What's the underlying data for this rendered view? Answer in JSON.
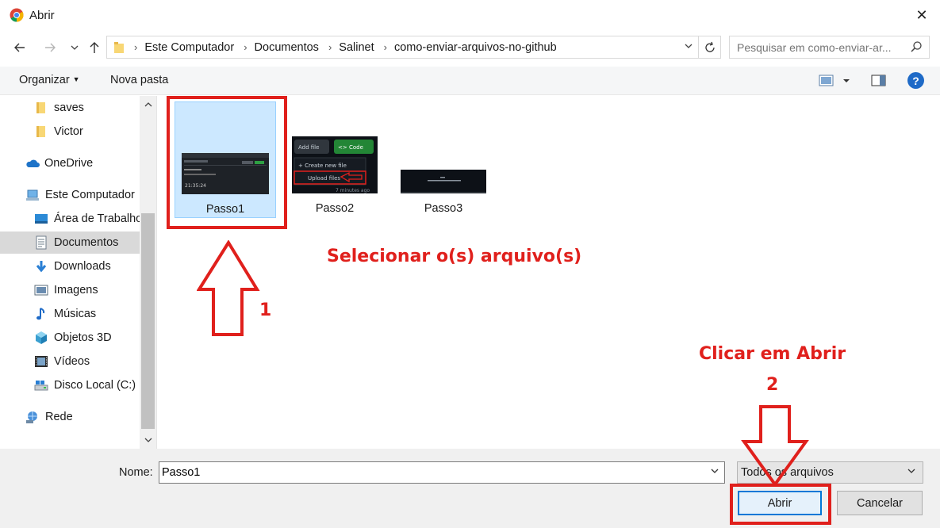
{
  "window": {
    "title": "Abrir",
    "close_label": "✕"
  },
  "nav": {
    "breadcrumbs": [
      "Este Computador",
      "Documentos",
      "Salinet",
      "como-enviar-arquivos-no-github"
    ],
    "search_placeholder": "Pesquisar em como-enviar-ar..."
  },
  "toolbar": {
    "organize_label": "Organizar",
    "new_folder_label": "Nova pasta",
    "help_label": "?"
  },
  "sidebar": {
    "items": [
      {
        "label": "saves",
        "icon": "folder-icon"
      },
      {
        "label": "Victor",
        "icon": "folder-icon"
      },
      {
        "label": "OneDrive",
        "icon": "cloud-icon"
      },
      {
        "label": "Este Computador",
        "icon": "computer-icon"
      },
      {
        "label": "Área de Trabalho",
        "icon": "desktop-icon"
      },
      {
        "label": "Documentos",
        "icon": "documents-icon",
        "selected": true
      },
      {
        "label": "Downloads",
        "icon": "download-icon"
      },
      {
        "label": "Imagens",
        "icon": "pictures-icon"
      },
      {
        "label": "Músicas",
        "icon": "music-icon"
      },
      {
        "label": "Objetos 3D",
        "icon": "cube-icon"
      },
      {
        "label": "Vídeos",
        "icon": "video-icon"
      },
      {
        "label": "Disco Local (C:)",
        "icon": "disk-icon"
      },
      {
        "label": "Rede",
        "icon": "network-icon"
      }
    ]
  },
  "files": [
    {
      "name": "Passo1",
      "selected": true
    },
    {
      "name": "Passo2",
      "selected": false
    },
    {
      "name": "Passo3",
      "selected": false
    }
  ],
  "thumb_text": {
    "passo1_time": "21:35:24",
    "passo2_add_file": "Add file",
    "passo2_code": "<> Code",
    "passo2_create": "+ Create new file",
    "passo2_upload": "Upload files",
    "passo2_ago": "7 minutes ago"
  },
  "bottom": {
    "name_label": "Nome:",
    "name_value": "Passo1",
    "file_type": "Todos os arquivos",
    "open_label": "Abrir",
    "cancel_label": "Cancelar"
  },
  "annotations": {
    "select_text": "Selecionar o(s) arquivo(s)",
    "step1": "1",
    "click_text": "Clicar em Abrir",
    "step2": "2",
    "color": "#e0201c"
  }
}
